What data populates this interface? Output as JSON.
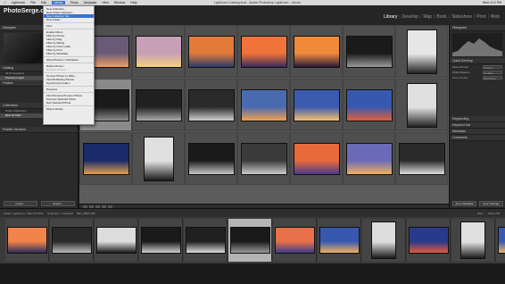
{
  "menubar": {
    "apple_icon": "apple-icon",
    "items": [
      "Lightroom",
      "File",
      "Edit",
      "Library",
      "Photo",
      "Metadata",
      "View",
      "Window",
      "Help"
    ],
    "active_index": 3,
    "window_title": "Lightroom Catalog.lrcat - Adobe Photoshop Lightroom - Library",
    "clock": "Wed 4:12 PM"
  },
  "app": {
    "logo": "PhotoSerge.com",
    "modules": [
      "Library",
      "Develop",
      "Map",
      "Book",
      "Slideshow",
      "Print",
      "Web"
    ],
    "active_module": "Library"
  },
  "left_panel": {
    "navigator_label": "Navigator",
    "catalog_label": "Catalog",
    "catalog_rows": [
      "All Photographs",
      "Previous Import"
    ],
    "folders_label": "Folders",
    "collections_label": "Collections",
    "collection_rows": [
      "Smart Collections",
      "Best Of Paris"
    ],
    "publish_label": "Publish Services",
    "import_label": "Import...",
    "export_label": "Export..."
  },
  "right_panel": {
    "histogram_label": "Histogram",
    "quick_develop_label": "Quick Develop",
    "rows": [
      {
        "label": "Saved Preset",
        "value": "Custom"
      },
      {
        "label": "White Balance",
        "value": "As Shot"
      },
      {
        "label": "Tone Control",
        "value": "Auto Tone"
      }
    ],
    "keywording_label": "Keywording",
    "keyword_list_label": "Keyword List",
    "metadata_label": "Metadata",
    "comments_label": "Comments",
    "sync_label": "Sync Settings",
    "sync_meta_label": "Sync Metadata"
  },
  "grid": {
    "thumbnails": [
      {
        "tone": "#6a5a7a",
        "accent": "#f0a060"
      },
      {
        "tone": "#c7a0b8",
        "accent": "#f6d27a"
      },
      {
        "tone": "#e27a3a",
        "accent": "#2a3a6a"
      },
      {
        "tone": "#f0743a",
        "accent": "#3a2a5a"
      },
      {
        "tone": "#f08a3a",
        "accent": "#2a1a3a"
      },
      {
        "tone": "#1a1a1a",
        "accent": "#9a9a9a"
      },
      {
        "tone": "#e6e6e6",
        "accent": "#222222"
      },
      {
        "tone": "#1a1a1a",
        "accent": "#8a8a8a"
      },
      {
        "tone": "#202020",
        "accent": "#aaaaaa"
      },
      {
        "tone": "#2a2a2a",
        "accent": "#cfcfcf"
      },
      {
        "tone": "#4a6ab0",
        "accent": "#f0a050"
      },
      {
        "tone": "#3a5ab0",
        "accent": "#f4c070"
      },
      {
        "tone": "#3858b0",
        "accent": "#e0603a"
      },
      {
        "tone": "#e0e0e0",
        "accent": "#222222"
      },
      {
        "tone": "#1a2a6a",
        "accent": "#e0a050"
      },
      {
        "tone": "#e0e0e0",
        "accent": "#1a1a1a"
      },
      {
        "tone": "#1a1a1a",
        "accent": "#c8c8c8"
      },
      {
        "tone": "#3a3a3a",
        "accent": "#cccccc"
      },
      {
        "tone": "#e86a3a",
        "accent": "#4a3a8a"
      },
      {
        "tone": "#6a6ab8",
        "accent": "#f0b060"
      },
      {
        "tone": "#2a2a2a",
        "accent": "#dddddd"
      }
    ],
    "selected_index": 7
  },
  "strip_bar": {
    "source": "Folder: Lightroom > Best Of Paris",
    "count": "79 photos / 1 selected",
    "filename": "IMG_2648.CR2",
    "filter_label": "Filter :",
    "filter_value": "Filters Off"
  },
  "filmstrip": {
    "frames": [
      {
        "tone": "#f0844a",
        "accent": "#2a2a5a"
      },
      {
        "tone": "#2a2a2a",
        "accent": "#bbbbbb"
      },
      {
        "tone": "#dcdcdc",
        "accent": "#1a1a1a"
      },
      {
        "tone": "#1a1a1a",
        "accent": "#cfcfcf"
      },
      {
        "tone": "#202020",
        "accent": "#dddddd"
      },
      {
        "tone": "#1a1a1a",
        "accent": "#9a9a9a"
      },
      {
        "tone": "#e8704a",
        "accent": "#3a3a8a"
      },
      {
        "tone": "#3858b0",
        "accent": "#f0b060"
      },
      {
        "tone": "#dcdcdc",
        "accent": "#1a1a1a"
      },
      {
        "tone": "#2a3a8a",
        "accent": "#e05a3a"
      },
      {
        "tone": "#e0e0e0",
        "accent": "#1a1a1a"
      },
      {
        "tone": "#3a5ab0",
        "accent": "#f4b060"
      }
    ],
    "selected_index": 5
  },
  "file_menu": {
    "items": [
      {
        "label": "New Collection...",
        "state": "normal"
      },
      {
        "label": "New Smart Collection...",
        "state": "normal"
      },
      {
        "label": "New Collection Set...",
        "state": "hl"
      },
      {
        "label": "New Folder...",
        "state": "normal"
      },
      {
        "label": "---"
      },
      {
        "label": "Find",
        "state": "normal"
      },
      {
        "label": "---"
      },
      {
        "label": "Enable Filters",
        "state": "normal"
      },
      {
        "label": "Filter by Preset",
        "state": "normal"
      },
      {
        "label": "Filter by Flag",
        "state": "normal"
      },
      {
        "label": "Filter by Rating",
        "state": "normal"
      },
      {
        "label": "Filter by Color Label",
        "state": "normal"
      },
      {
        "label": "Filter by Kind",
        "state": "normal"
      },
      {
        "label": "Filter by Metadata",
        "state": "normal"
      },
      {
        "label": "---"
      },
      {
        "label": "Show Photos in Subfolders",
        "state": "normal"
      },
      {
        "label": "---"
      },
      {
        "label": "Refine Photos...",
        "state": "normal"
      },
      {
        "label": "Rename Photos...",
        "state": "dim"
      },
      {
        "label": "---"
      },
      {
        "label": "Convert Photos to DNG...",
        "state": "normal"
      },
      {
        "label": "Find All Missing Photos",
        "state": "normal"
      },
      {
        "label": "Synchronize Folder...",
        "state": "normal"
      },
      {
        "label": "---"
      },
      {
        "label": "Previews",
        "state": "normal"
      },
      {
        "label": "---"
      },
      {
        "label": "Find Previous Process Photos",
        "state": "normal"
      },
      {
        "label": "Previous Selected Photo",
        "state": "normal"
      },
      {
        "label": "Next Selected Photo",
        "state": "normal"
      },
      {
        "label": "---"
      },
      {
        "label": "Plug-in Extras",
        "state": "normal"
      }
    ]
  }
}
